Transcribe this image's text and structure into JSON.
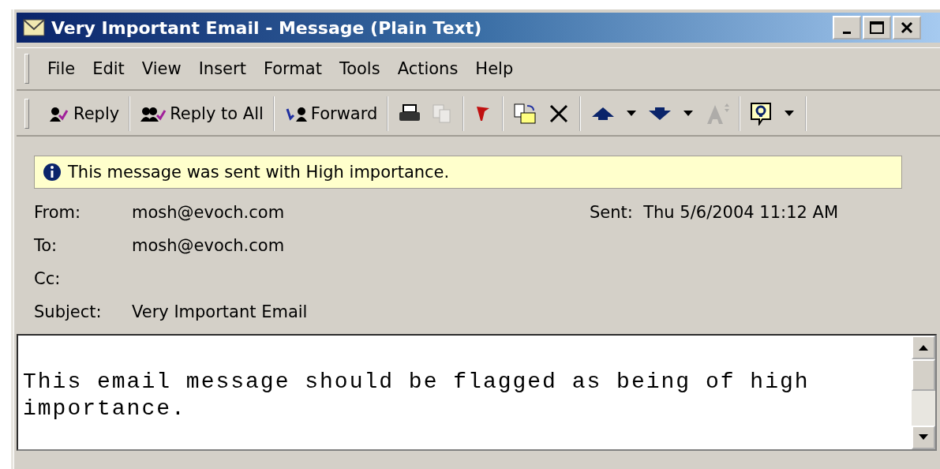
{
  "window": {
    "title": "Very Important Email - Message (Plain Text)"
  },
  "menu": [
    {
      "label": "File"
    },
    {
      "label": "Edit"
    },
    {
      "label": "View"
    },
    {
      "label": "Insert"
    },
    {
      "label": "Format"
    },
    {
      "label": "Tools"
    },
    {
      "label": "Actions"
    },
    {
      "label": "Help"
    }
  ],
  "toolbar": [
    [
      {
        "kind": "button",
        "label": "Reply"
      }
    ],
    [
      {
        "kind": "button",
        "label": "Reply to All"
      }
    ],
    [
      {
        "kind": "button",
        "label": "Forward"
      }
    ],
    [
      {
        "kind": "icon",
        "disabled": false
      },
      {
        "kind": "icon",
        "disabled": true
      }
    ],
    [
      {
        "kind": "icon",
        "disabled": false
      }
    ],
    [
      {
        "kind": "icon",
        "disabled": false
      },
      {
        "kind": "icon",
        "disabled": false
      }
    ],
    [
      {
        "kind": "icon",
        "disabled": false
      },
      {
        "kind": "dropdown"
      },
      {
        "kind": "icon",
        "disabled": false
      },
      {
        "kind": "dropdown"
      },
      {
        "kind": "icon",
        "disabled": true
      }
    ],
    [
      {
        "kind": "icon",
        "disabled": false
      },
      {
        "kind": "dropdown"
      }
    ]
  ],
  "info_bar": {
    "text": "This message was sent with High importance."
  },
  "headers": [
    {
      "label": "From:",
      "value": "mosh@evoch.com"
    },
    {
      "label": "To:",
      "value": "mosh@evoch.com"
    },
    {
      "label": "Cc:"
    },
    {
      "label": "Subject:",
      "value": "Very Important Email"
    }
  ],
  "sent": {
    "label": "Sent:",
    "value": "Thu 5/6/2004 11:12 AM"
  },
  "body": {
    "text": "This email message should be flagged as being of high importance."
  }
}
